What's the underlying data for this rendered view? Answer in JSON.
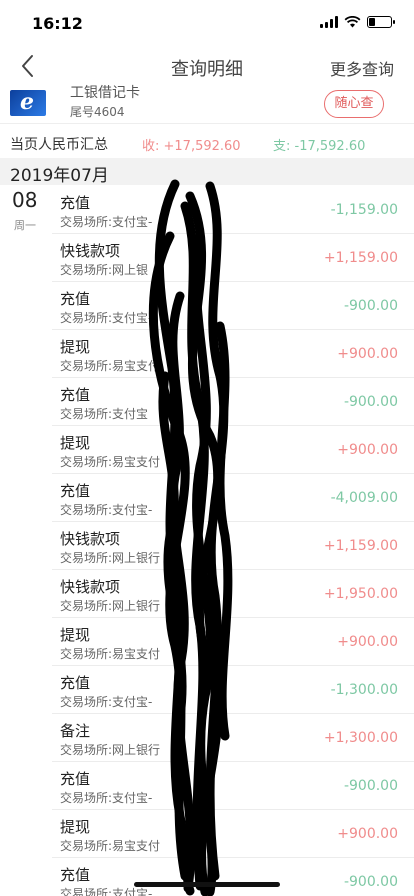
{
  "status": {
    "time": "16:12"
  },
  "nav": {
    "title": "查询明细",
    "more": "更多查询"
  },
  "card": {
    "name": "工银借记卡",
    "tail": "尾号4604",
    "button": "随心查"
  },
  "summary": {
    "label": "当页人民币汇总",
    "income": "收: +17,592.60",
    "expense": "支: -17,592.60"
  },
  "month": "2019年07月",
  "date": {
    "day": "08",
    "weekday": "周一"
  },
  "colors": {
    "income": "#f08c8c",
    "expense": "#7ec8a4"
  },
  "transactions": [
    {
      "title": "充值",
      "place": "交易场所:支付宝-",
      "amount": "-1,159.00",
      "type": "expense"
    },
    {
      "title": "快钱款项",
      "place": "交易场所:网上银",
      "amount": "+1,159.00",
      "type": "income"
    },
    {
      "title": "充值",
      "place": "交易场所:支付宝-",
      "amount": "-900.00",
      "type": "expense"
    },
    {
      "title": "提现",
      "place": "交易场所:易宝支付",
      "amount": "+900.00",
      "type": "income"
    },
    {
      "title": "充值",
      "place": "交易场所:支付宝",
      "amount": "-900.00",
      "type": "expense"
    },
    {
      "title": "提现",
      "place": "交易场所:易宝支付",
      "amount": "+900.00",
      "type": "income"
    },
    {
      "title": "充值",
      "place": "交易场所:支付宝-",
      "amount": "-4,009.00",
      "type": "expense"
    },
    {
      "title": "快钱款项",
      "place": "交易场所:网上银行",
      "amount": "+1,159.00",
      "type": "income"
    },
    {
      "title": "快钱款项",
      "place": "交易场所:网上银行",
      "amount": "+1,950.00",
      "type": "income"
    },
    {
      "title": "提现",
      "place": "交易场所:易宝支付",
      "amount": "+900.00",
      "type": "income"
    },
    {
      "title": "充值",
      "place": "交易场所:支付宝-",
      "amount": "-1,300.00",
      "type": "expense"
    },
    {
      "title": "备注",
      "place": "交易场所:网上银行",
      "amount": "+1,300.00",
      "type": "income"
    },
    {
      "title": "充值",
      "place": "交易场所:支付宝-",
      "amount": "-900.00",
      "type": "expense"
    },
    {
      "title": "提现",
      "place": "交易场所:易宝支付",
      "amount": "+900.00",
      "type": "income"
    },
    {
      "title": "充值",
      "place": "交易场所:支付宝-",
      "amount": "-900.00",
      "type": "expense"
    }
  ]
}
